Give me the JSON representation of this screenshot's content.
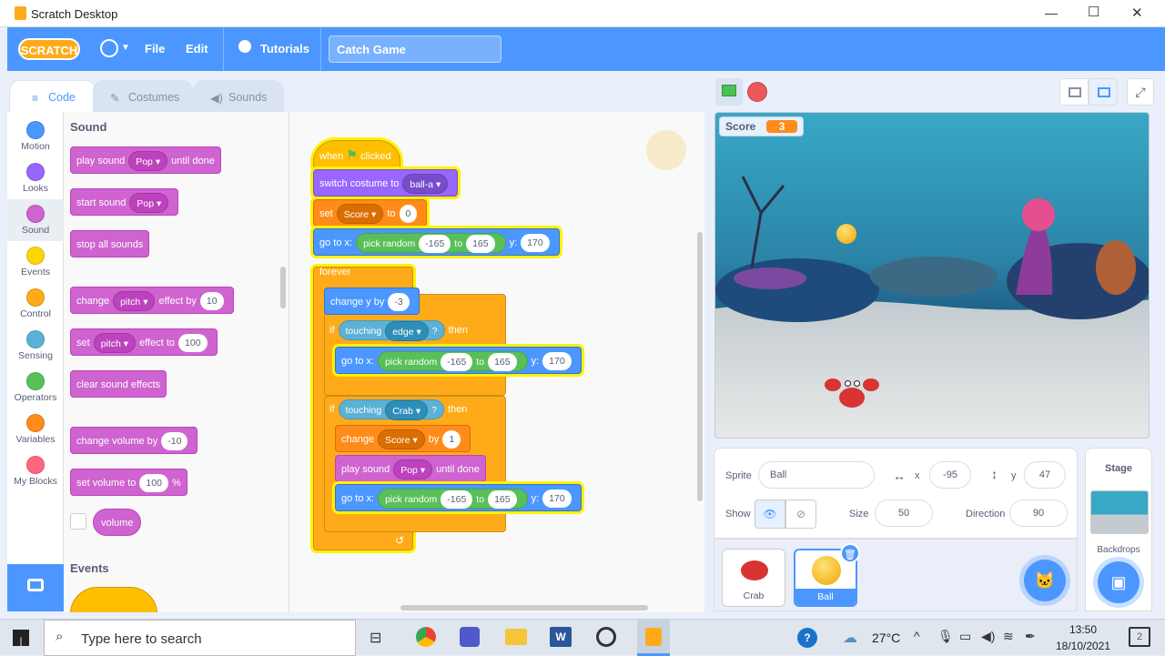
{
  "window": {
    "title": "Scratch Desktop",
    "controls": [
      "—",
      "☐",
      "✕"
    ]
  },
  "menu": {
    "logo": "SCRATCH",
    "file": "File",
    "edit": "Edit",
    "tutorials": "Tutorials",
    "project_title": "Catch Game"
  },
  "tabs": {
    "code": "Code",
    "costumes": "Costumes",
    "sounds": "Sounds"
  },
  "categories": [
    {
      "label": "Motion",
      "color": "#4c97ff"
    },
    {
      "label": "Looks",
      "color": "#9966ff"
    },
    {
      "label": "Sound",
      "color": "#cf63cf"
    },
    {
      "label": "Events",
      "color": "#ffd500"
    },
    {
      "label": "Control",
      "color": "#ffab19"
    },
    {
      "label": "Sensing",
      "color": "#5cb1d6"
    },
    {
      "label": "Operators",
      "color": "#59c059"
    },
    {
      "label": "Variables",
      "color": "#ff8c1a"
    },
    {
      "label": "My Blocks",
      "color": "#ff6680"
    }
  ],
  "palette": {
    "section_sound": "Sound",
    "play_sound": "play sound",
    "play_sound_val": "Pop",
    "until_done": "until done",
    "start_sound": "start sound",
    "start_sound_val": "Pop",
    "stop_all": "stop all sounds",
    "change": "change",
    "pitch": "pitch",
    "effect_by": "effect by",
    "effect_by_val": "10",
    "set": "set",
    "effect_to": "effect to",
    "effect_to_val": "100",
    "clear_effects": "clear sound effects",
    "change_volume": "change volume by",
    "change_volume_val": "-10",
    "set_volume": "set volume to",
    "set_volume_val": "100",
    "percent": "%",
    "volume": "volume",
    "section_events": "Events"
  },
  "script": {
    "when": "when",
    "clicked": "clicked",
    "switch_costume": "switch costume to",
    "costume_val": "ball-a",
    "set": "set",
    "score": "Score",
    "to": "to",
    "zero": "0",
    "go_to_x": "go to x:",
    "pick_random": "pick random",
    "neg165": "-165",
    "to2": "to",
    "pos165": "165",
    "y": "y:",
    "y170": "170",
    "forever": "forever",
    "change_y": "change y by",
    "change_y_val": "-3",
    "if": "if",
    "touching": "touching",
    "edge": "edge",
    "q": "?",
    "then": "then",
    "crab": "Crab",
    "change": "change",
    "by": "by",
    "one": "1",
    "play_sound": "play sound",
    "pop": "Pop",
    "until_done": "until done"
  },
  "stage": {
    "score_label": "Score",
    "score_value": "3"
  },
  "sprite_info": {
    "sprite_label": "Sprite",
    "sprite_name": "Ball",
    "x_label": "x",
    "x": "-95",
    "y_label": "y",
    "y": "47",
    "show_label": "Show",
    "size_label": "Size",
    "size": "50",
    "direction_label": "Direction",
    "direction": "90"
  },
  "sprites": [
    {
      "name": "Crab"
    },
    {
      "name": "Ball"
    }
  ],
  "stage_panel": {
    "title": "Stage",
    "backdrops": "Backdrops"
  },
  "taskbar": {
    "search_placeholder": "Type here to search",
    "temp": "27°C",
    "time": "13:50",
    "date": "18/10/2021",
    "notif": "2"
  }
}
